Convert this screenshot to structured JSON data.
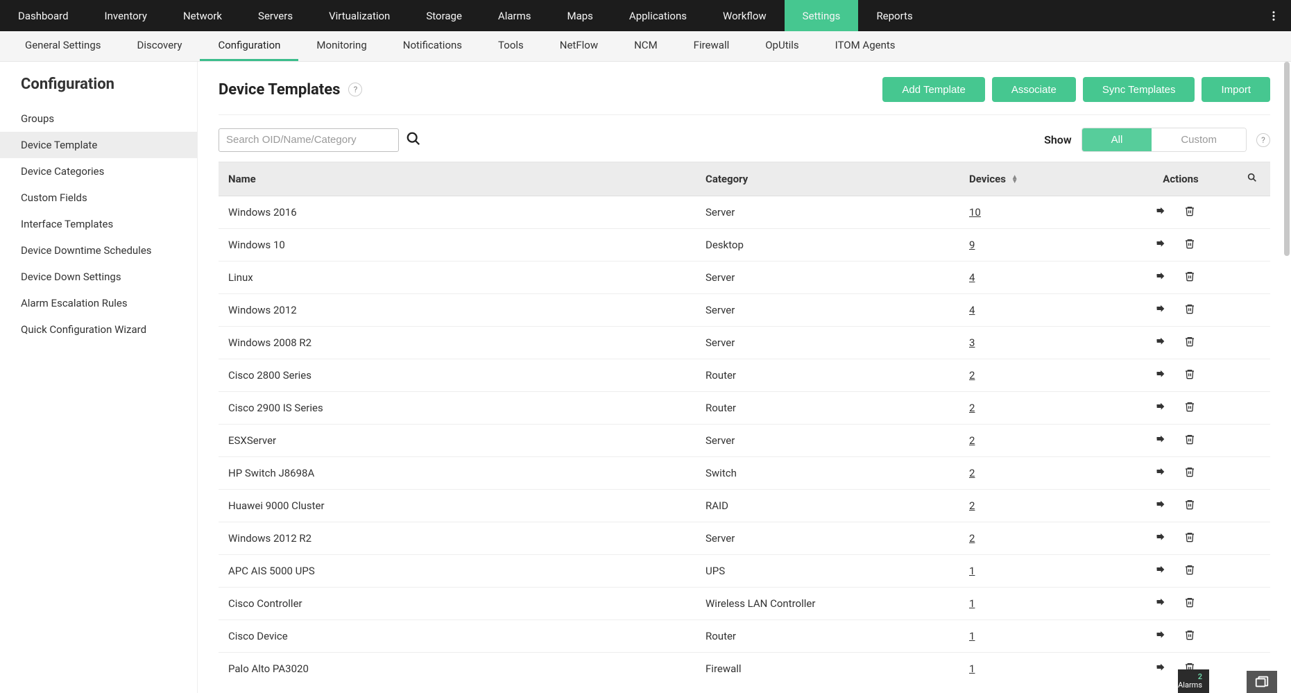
{
  "topnav": {
    "items": [
      "Dashboard",
      "Inventory",
      "Network",
      "Servers",
      "Virtualization",
      "Storage",
      "Alarms",
      "Maps",
      "Applications",
      "Workflow",
      "Settings",
      "Reports"
    ],
    "active": 10
  },
  "subnav": {
    "items": [
      "General Settings",
      "Discovery",
      "Configuration",
      "Monitoring",
      "Notifications",
      "Tools",
      "NetFlow",
      "NCM",
      "Firewall",
      "OpUtils",
      "ITOM Agents"
    ],
    "active": 2
  },
  "sidebar": {
    "title": "Configuration",
    "items": [
      "Groups",
      "Device Template",
      "Device Categories",
      "Custom Fields",
      "Interface Templates",
      "Device Downtime Schedules",
      "Device Down Settings",
      "Alarm Escalation Rules",
      "Quick Configuration Wizard"
    ],
    "active": 1
  },
  "page": {
    "title": "Device Templates",
    "help": "?",
    "buttons": {
      "add": "Add Template",
      "associate": "Associate",
      "sync": "Sync Templates",
      "import": "Import"
    },
    "search_placeholder": "Search OID/Name/Category",
    "show_label": "Show",
    "seg": {
      "all": "All",
      "custom": "Custom"
    },
    "seg_help": "?"
  },
  "table": {
    "headers": {
      "name": "Name",
      "category": "Category",
      "devices": "Devices",
      "actions": "Actions"
    },
    "rows": [
      {
        "name": "Windows 2016",
        "category": "Server",
        "devices": "10"
      },
      {
        "name": "Windows 10",
        "category": "Desktop",
        "devices": "9"
      },
      {
        "name": "Linux",
        "category": "Server",
        "devices": "4"
      },
      {
        "name": "Windows 2012",
        "category": "Server",
        "devices": "4"
      },
      {
        "name": "Windows 2008 R2",
        "category": "Server",
        "devices": "3"
      },
      {
        "name": "Cisco 2800 Series",
        "category": "Router",
        "devices": "2"
      },
      {
        "name": "Cisco 2900 IS Series",
        "category": "Router",
        "devices": "2"
      },
      {
        "name": "ESXServer",
        "category": "Server",
        "devices": "2"
      },
      {
        "name": "HP Switch J8698A",
        "category": "Switch",
        "devices": "2"
      },
      {
        "name": "Huawei 9000 Cluster",
        "category": "RAID",
        "devices": "2"
      },
      {
        "name": "Windows 2012 R2",
        "category": "Server",
        "devices": "2"
      },
      {
        "name": "APC AIS 5000 UPS",
        "category": "UPS",
        "devices": "1"
      },
      {
        "name": "Cisco Controller",
        "category": "Wireless LAN Controller",
        "devices": "1"
      },
      {
        "name": "Cisco Device",
        "category": "Router",
        "devices": "1"
      },
      {
        "name": "Palo Alto PA3020",
        "category": "Firewall",
        "devices": "1"
      }
    ]
  },
  "alarm": {
    "count": "2",
    "label": "Alarms"
  }
}
